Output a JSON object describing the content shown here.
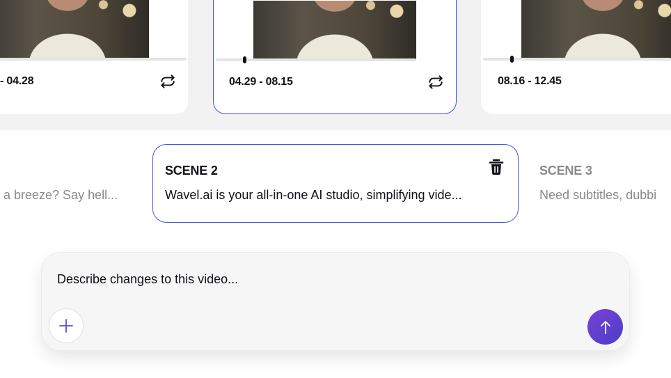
{
  "clips": [
    {
      "range": "- 04.28",
      "active": false
    },
    {
      "range": "04.29 - 08.15",
      "active": true
    },
    {
      "range": "08.16 - 12.45",
      "active": false
    }
  ],
  "scenes": [
    {
      "title": "",
      "text": "a breeze? Say hell..."
    },
    {
      "title": "SCENE 2",
      "text": "Wavel.ai is your all-in-one AI studio, simplifying vide..."
    },
    {
      "title": "SCENE 3",
      "text": "Need subtitles, dubbi"
    }
  ],
  "prompt": {
    "placeholder": "Describe changes to this video..."
  },
  "colors": {
    "accent": "#3f5bd8",
    "send_start": "#7a3fd8",
    "send_end": "#4b3fc6",
    "muted_text": "#8a8a8a"
  },
  "icons": {
    "swap": "swap-icon",
    "trash": "trash-icon",
    "add": "plus-icon",
    "send": "arrow-up-icon"
  }
}
